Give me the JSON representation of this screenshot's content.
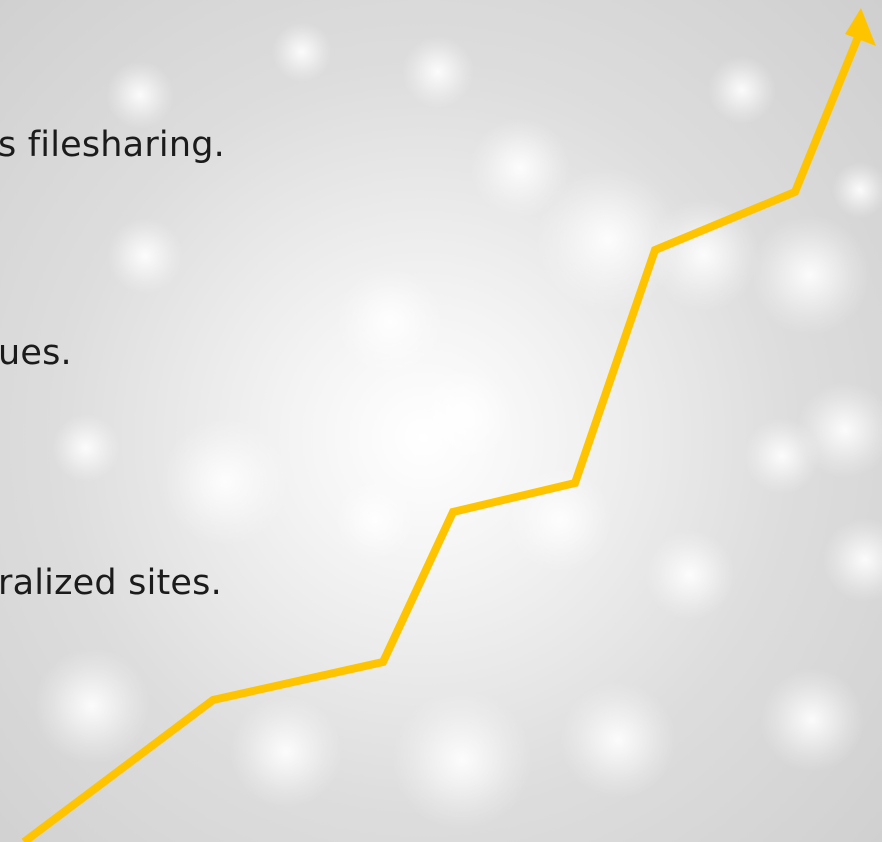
{
  "slide": {
    "lines": [
      "s filesharing.",
      "ues.",
      "ralized sites."
    ],
    "accent_color": "#FFC400",
    "text_color": "#1B1B1B"
  }
}
